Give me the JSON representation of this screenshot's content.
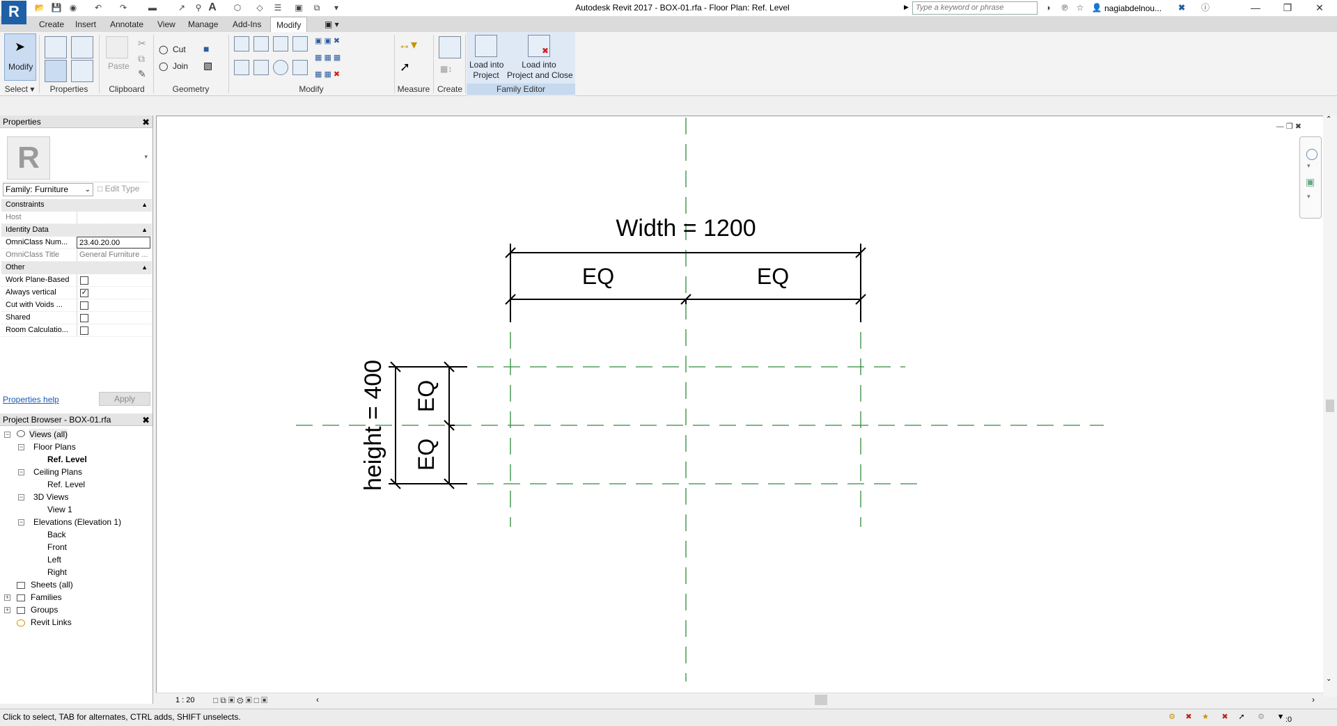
{
  "app": {
    "title": "Autodesk Revit 2017 -    BOX-01.rfa - Floor Plan: Ref. Level",
    "logo": "R",
    "search_placeholder": "Type a keyword or phrase",
    "user": "nagiabdelnou...",
    "window_controls": [
      "minimize-icon",
      "maximize-icon",
      "close-icon"
    ]
  },
  "ribbon_tabs": [
    "Create",
    "Insert",
    "Annotate",
    "View",
    "Manage",
    "Add-Ins",
    "Modify"
  ],
  "active_tab": "Modify",
  "ribbon": {
    "modify_label": "Modify",
    "paste_label": "Paste",
    "cut_label": "Cut",
    "join_label": "Join",
    "load_into_project_line1": "Load into",
    "load_into_project_line2": "Project",
    "load_close_line1": "Load into",
    "load_close_line2": "Project and Close",
    "panels": [
      "Select",
      "Properties",
      "Clipboard",
      "Geometry",
      "Modify",
      "Measure",
      "Create",
      "Family Editor"
    ]
  },
  "properties": {
    "header": "Properties",
    "type_selector": "Family: Furniture",
    "edit_type": "Edit Type",
    "groups": {
      "constraints": "Constraints",
      "identity": "Identity Data",
      "other": "Other"
    },
    "rows": {
      "host": {
        "label": "Host",
        "value": ""
      },
      "omniclass_num": {
        "label": "OmniClass Num...",
        "value": "23.40.20.00"
      },
      "omniclass_title": {
        "label": "OmniClass Title",
        "value": "General Furniture ..."
      },
      "work_plane": {
        "label": "Work Plane-Based",
        "checked": false
      },
      "always_vertical": {
        "label": "Always vertical",
        "checked": true
      },
      "cut_voids": {
        "label": "Cut with Voids ...",
        "checked": false
      },
      "shared": {
        "label": "Shared",
        "checked": false
      },
      "room_calc": {
        "label": "Room Calculatio...",
        "checked": false
      }
    },
    "help_link": "Properties help",
    "apply": "Apply"
  },
  "browser": {
    "header": "Project Browser - BOX-01.rfa",
    "items": {
      "views_all": "Views (all)",
      "floor_plans": "Floor Plans",
      "fp_ref": "Ref. Level",
      "ceiling_plans": "Ceiling Plans",
      "cp_ref": "Ref. Level",
      "views_3d": "3D Views",
      "view1": "View 1",
      "elevations": "Elevations (Elevation 1)",
      "back": "Back",
      "front": "Front",
      "left": "Left",
      "right": "Right",
      "sheets": "Sheets (all)",
      "families": "Families",
      "groups": "Groups",
      "links": "Revit Links"
    }
  },
  "drawing": {
    "width_label": "Width = 1200",
    "height_label": "height = 400",
    "eq": "EQ"
  },
  "view_controls": {
    "scale": "1 : 20"
  },
  "status": {
    "hint": "Click to select, TAB for alternates, CTRL adds, SHIFT unselects.",
    "filter_count": ":0"
  },
  "colors": {
    "ref_plane": "#2e8b3a",
    "accent": "#1f5fa6"
  }
}
